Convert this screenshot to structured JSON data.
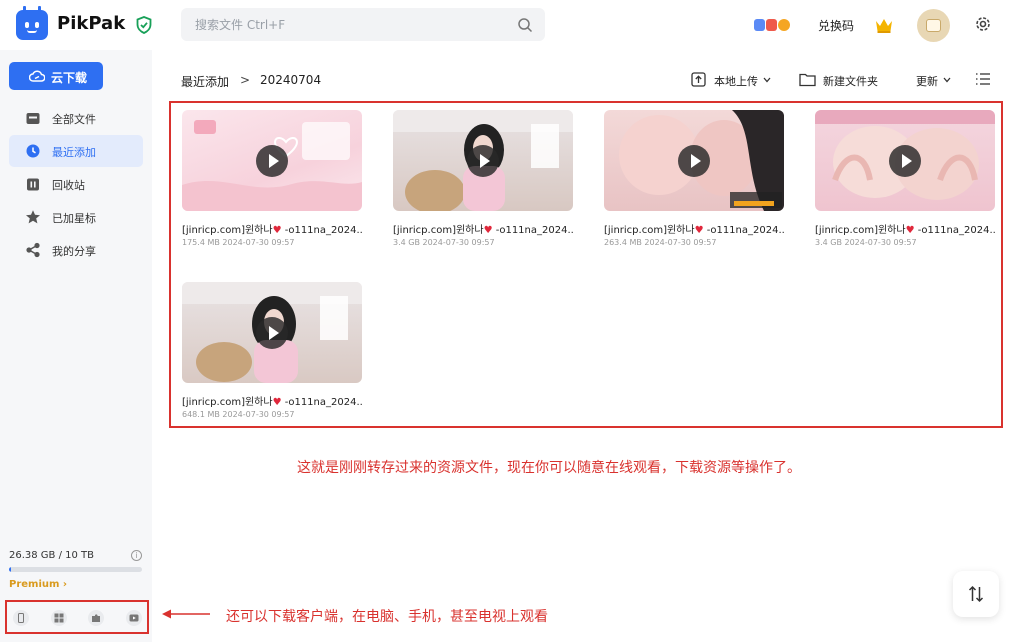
{
  "header": {
    "brand": "PikPak",
    "search_placeholder": "搜索文件 Ctrl+F",
    "redeem_label": "兑换码"
  },
  "sidebar": {
    "cloud_download": "云下载",
    "items": [
      {
        "label": "全部文件",
        "icon": "folder-icon",
        "active": false
      },
      {
        "label": "最近添加",
        "icon": "clock-icon",
        "active": true
      },
      {
        "label": "回收站",
        "icon": "trash-icon",
        "active": false
      },
      {
        "label": "已加星标",
        "icon": "star-icon",
        "active": false
      },
      {
        "label": "我的分享",
        "icon": "share-icon",
        "active": false
      }
    ],
    "storage_text": "26.38 GB / 10 TB",
    "storage_fraction": 0.0026,
    "premium_label": "Premium ›"
  },
  "breadcrumb": {
    "root": "最近添加",
    "separator": ">",
    "current": "20240704"
  },
  "toolbar": {
    "upload": "本地上传",
    "new_folder": "新建文件夹",
    "sort": "更新"
  },
  "files": [
    {
      "name_pre": "[jinricp.com]윈하나",
      "name_post": "-o111na_2024...",
      "size": "175.4 MB",
      "date": "2024-07-30 09:57"
    },
    {
      "name_pre": "[jinricp.com]윈하나",
      "name_post": "-o111na_2024...",
      "size": "3.4 GB",
      "date": "2024-07-30 09:57"
    },
    {
      "name_pre": "[jinricp.com]윈하나",
      "name_post": "-o111na_2024...",
      "size": "263.4 MB",
      "date": "2024-07-30 09:57"
    },
    {
      "name_pre": "[jinricp.com]윈하나",
      "name_post": "-o111na_2024...",
      "size": "3.4 GB",
      "date": "2024-07-30 09:57"
    },
    {
      "name_pre": "[jinricp.com]윈하나",
      "name_post": "-o111na_2024...",
      "size": "648.1 MB",
      "date": "2024-07-30 09:57"
    }
  ],
  "annotations": {
    "files_note": "这就是刚刚转存过来的资源文件，现在你可以随意在线观看，下载资源等操作了。",
    "clients_note": "还可以下载客户端，在电脑、手机，甚至电视上观看"
  },
  "colors": {
    "accent": "#2e6ff2",
    "annotation": "#d9322e",
    "premium": "#d99a1e"
  }
}
